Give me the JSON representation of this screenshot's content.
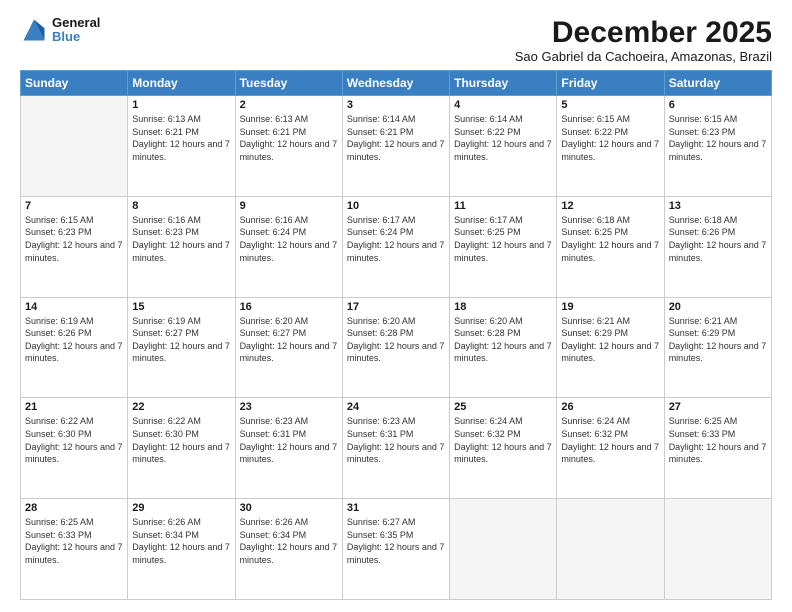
{
  "logo": {
    "line1": "General",
    "line2": "Blue"
  },
  "title": "December 2025",
  "subtitle": "Sao Gabriel da Cachoeira, Amazonas, Brazil",
  "days_of_week": [
    "Sunday",
    "Monday",
    "Tuesday",
    "Wednesday",
    "Thursday",
    "Friday",
    "Saturday"
  ],
  "weeks": [
    [
      {
        "num": "",
        "sunrise": "",
        "sunset": "",
        "daylight": ""
      },
      {
        "num": "1",
        "sunrise": "Sunrise: 6:13 AM",
        "sunset": "Sunset: 6:21 PM",
        "daylight": "Daylight: 12 hours and 7 minutes."
      },
      {
        "num": "2",
        "sunrise": "Sunrise: 6:13 AM",
        "sunset": "Sunset: 6:21 PM",
        "daylight": "Daylight: 12 hours and 7 minutes."
      },
      {
        "num": "3",
        "sunrise": "Sunrise: 6:14 AM",
        "sunset": "Sunset: 6:21 PM",
        "daylight": "Daylight: 12 hours and 7 minutes."
      },
      {
        "num": "4",
        "sunrise": "Sunrise: 6:14 AM",
        "sunset": "Sunset: 6:22 PM",
        "daylight": "Daylight: 12 hours and 7 minutes."
      },
      {
        "num": "5",
        "sunrise": "Sunrise: 6:15 AM",
        "sunset": "Sunset: 6:22 PM",
        "daylight": "Daylight: 12 hours and 7 minutes."
      },
      {
        "num": "6",
        "sunrise": "Sunrise: 6:15 AM",
        "sunset": "Sunset: 6:23 PM",
        "daylight": "Daylight: 12 hours and 7 minutes."
      }
    ],
    [
      {
        "num": "7",
        "sunrise": "Sunrise: 6:15 AM",
        "sunset": "Sunset: 6:23 PM",
        "daylight": "Daylight: 12 hours and 7 minutes."
      },
      {
        "num": "8",
        "sunrise": "Sunrise: 6:16 AM",
        "sunset": "Sunset: 6:23 PM",
        "daylight": "Daylight: 12 hours and 7 minutes."
      },
      {
        "num": "9",
        "sunrise": "Sunrise: 6:16 AM",
        "sunset": "Sunset: 6:24 PM",
        "daylight": "Daylight: 12 hours and 7 minutes."
      },
      {
        "num": "10",
        "sunrise": "Sunrise: 6:17 AM",
        "sunset": "Sunset: 6:24 PM",
        "daylight": "Daylight: 12 hours and 7 minutes."
      },
      {
        "num": "11",
        "sunrise": "Sunrise: 6:17 AM",
        "sunset": "Sunset: 6:25 PM",
        "daylight": "Daylight: 12 hours and 7 minutes."
      },
      {
        "num": "12",
        "sunrise": "Sunrise: 6:18 AM",
        "sunset": "Sunset: 6:25 PM",
        "daylight": "Daylight: 12 hours and 7 minutes."
      },
      {
        "num": "13",
        "sunrise": "Sunrise: 6:18 AM",
        "sunset": "Sunset: 6:26 PM",
        "daylight": "Daylight: 12 hours and 7 minutes."
      }
    ],
    [
      {
        "num": "14",
        "sunrise": "Sunrise: 6:19 AM",
        "sunset": "Sunset: 6:26 PM",
        "daylight": "Daylight: 12 hours and 7 minutes."
      },
      {
        "num": "15",
        "sunrise": "Sunrise: 6:19 AM",
        "sunset": "Sunset: 6:27 PM",
        "daylight": "Daylight: 12 hours and 7 minutes."
      },
      {
        "num": "16",
        "sunrise": "Sunrise: 6:20 AM",
        "sunset": "Sunset: 6:27 PM",
        "daylight": "Daylight: 12 hours and 7 minutes."
      },
      {
        "num": "17",
        "sunrise": "Sunrise: 6:20 AM",
        "sunset": "Sunset: 6:28 PM",
        "daylight": "Daylight: 12 hours and 7 minutes."
      },
      {
        "num": "18",
        "sunrise": "Sunrise: 6:20 AM",
        "sunset": "Sunset: 6:28 PM",
        "daylight": "Daylight: 12 hours and 7 minutes."
      },
      {
        "num": "19",
        "sunrise": "Sunrise: 6:21 AM",
        "sunset": "Sunset: 6:29 PM",
        "daylight": "Daylight: 12 hours and 7 minutes."
      },
      {
        "num": "20",
        "sunrise": "Sunrise: 6:21 AM",
        "sunset": "Sunset: 6:29 PM",
        "daylight": "Daylight: 12 hours and 7 minutes."
      }
    ],
    [
      {
        "num": "21",
        "sunrise": "Sunrise: 6:22 AM",
        "sunset": "Sunset: 6:30 PM",
        "daylight": "Daylight: 12 hours and 7 minutes."
      },
      {
        "num": "22",
        "sunrise": "Sunrise: 6:22 AM",
        "sunset": "Sunset: 6:30 PM",
        "daylight": "Daylight: 12 hours and 7 minutes."
      },
      {
        "num": "23",
        "sunrise": "Sunrise: 6:23 AM",
        "sunset": "Sunset: 6:31 PM",
        "daylight": "Daylight: 12 hours and 7 minutes."
      },
      {
        "num": "24",
        "sunrise": "Sunrise: 6:23 AM",
        "sunset": "Sunset: 6:31 PM",
        "daylight": "Daylight: 12 hours and 7 minutes."
      },
      {
        "num": "25",
        "sunrise": "Sunrise: 6:24 AM",
        "sunset": "Sunset: 6:32 PM",
        "daylight": "Daylight: 12 hours and 7 minutes."
      },
      {
        "num": "26",
        "sunrise": "Sunrise: 6:24 AM",
        "sunset": "Sunset: 6:32 PM",
        "daylight": "Daylight: 12 hours and 7 minutes."
      },
      {
        "num": "27",
        "sunrise": "Sunrise: 6:25 AM",
        "sunset": "Sunset: 6:33 PM",
        "daylight": "Daylight: 12 hours and 7 minutes."
      }
    ],
    [
      {
        "num": "28",
        "sunrise": "Sunrise: 6:25 AM",
        "sunset": "Sunset: 6:33 PM",
        "daylight": "Daylight: 12 hours and 7 minutes."
      },
      {
        "num": "29",
        "sunrise": "Sunrise: 6:26 AM",
        "sunset": "Sunset: 6:34 PM",
        "daylight": "Daylight: 12 hours and 7 minutes."
      },
      {
        "num": "30",
        "sunrise": "Sunrise: 6:26 AM",
        "sunset": "Sunset: 6:34 PM",
        "daylight": "Daylight: 12 hours and 7 minutes."
      },
      {
        "num": "31",
        "sunrise": "Sunrise: 6:27 AM",
        "sunset": "Sunset: 6:35 PM",
        "daylight": "Daylight: 12 hours and 7 minutes."
      },
      {
        "num": "",
        "sunrise": "",
        "sunset": "",
        "daylight": ""
      },
      {
        "num": "",
        "sunrise": "",
        "sunset": "",
        "daylight": ""
      },
      {
        "num": "",
        "sunrise": "",
        "sunset": "",
        "daylight": ""
      }
    ]
  ]
}
